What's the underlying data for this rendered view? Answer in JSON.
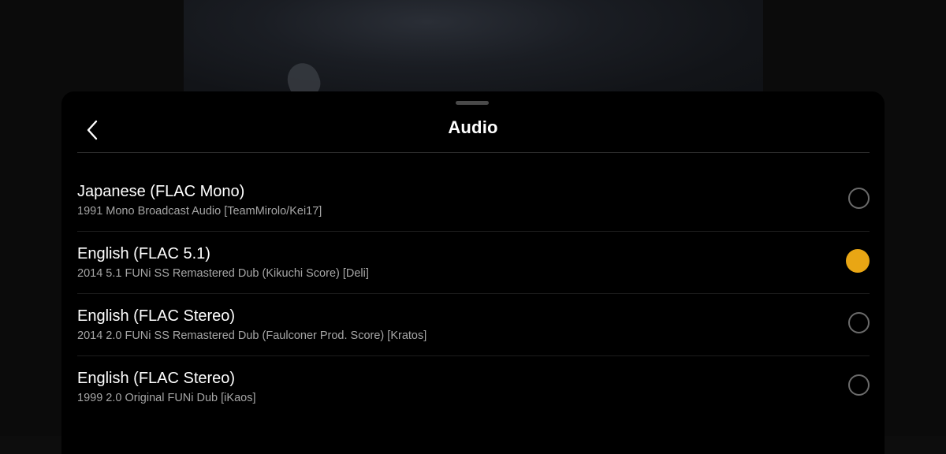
{
  "header": {
    "title": "Audio",
    "back_icon": "chevron-left-icon"
  },
  "colors": {
    "accent": "#e9a614",
    "sheet_background": "#000000",
    "primary_text": "#ffffff",
    "secondary_text": "#a6a6a6"
  },
  "tracks": [
    {
      "title": "Japanese (FLAC Mono)",
      "description": "1991 Mono Broadcast Audio [TeamMirolo/Kei17]",
      "selected": false
    },
    {
      "title": "English (FLAC 5.1)",
      "description": "2014 5.1 FUNi SS Remastered Dub (Kikuchi Score) [Deli]",
      "selected": true
    },
    {
      "title": "English (FLAC Stereo)",
      "description": "2014 2.0 FUNi SS Remastered Dub (Faulconer Prod. Score) [Kratos]",
      "selected": false
    },
    {
      "title": "English (FLAC Stereo)",
      "description": "1999 2.0 Original FUNi Dub [iKaos]",
      "selected": false
    }
  ]
}
